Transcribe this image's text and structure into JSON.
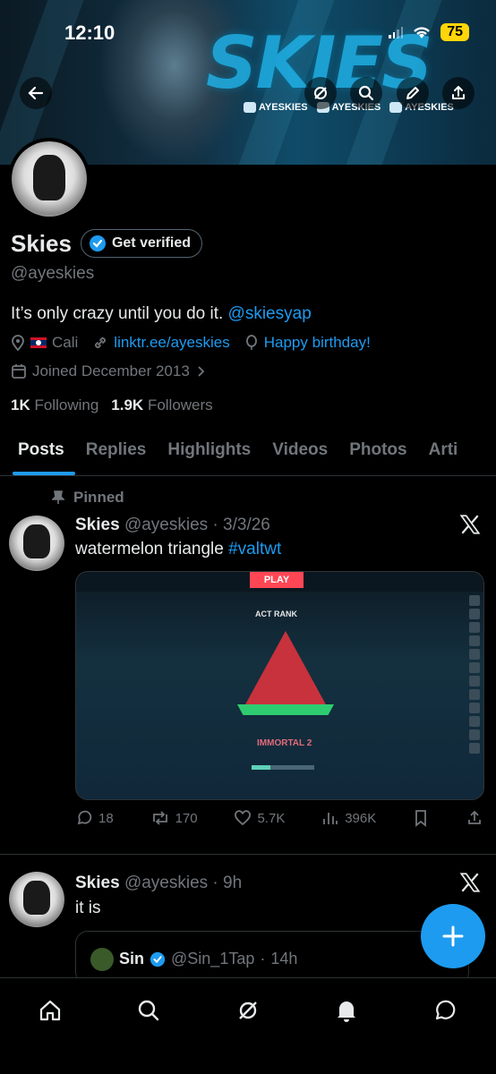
{
  "status_bar": {
    "time": "12:10",
    "battery": "75"
  },
  "banner": {
    "logo_text": "SKIES",
    "socials": [
      {
        "platform": "TWITTER",
        "handle": "AYESKIES"
      },
      {
        "platform": "YOUTUBE",
        "handle": "AYESKIES"
      },
      {
        "platform": "TWITCH",
        "handle": "AYESKIES"
      }
    ]
  },
  "profile": {
    "name": "Skies",
    "get_verified": "Get verified",
    "handle": "@ayeskies",
    "bio_text": "It’s only crazy until you do it.",
    "bio_mention": "@skiesyap",
    "location": "Cali",
    "link": "linktr.ee/ayeskies",
    "birthday": "Happy birthday!",
    "joined": "Joined December 2013",
    "following_count": "1K",
    "following_label": "Following",
    "followers_count": "1.9K",
    "followers_label": "Followers"
  },
  "tabs": [
    "Posts",
    "Replies",
    "Highlights",
    "Videos",
    "Photos",
    "Arti"
  ],
  "pinned_label": "Pinned",
  "tweets": [
    {
      "name": "Skies",
      "handle": "@ayeskies",
      "time": "3/3/26",
      "text": "watermelon triangle",
      "hashtag": "#valtwt",
      "media": {
        "play_label": "PLAY",
        "act_rank_label": "ACT RANK",
        "rank_name": "IMMORTAL 2"
      },
      "replies": "18",
      "reposts": "170",
      "likes": "5.7K",
      "views": "396K"
    },
    {
      "name": "Skies",
      "handle": "@ayeskies",
      "time": "9h",
      "text": "it is",
      "quote": {
        "name": "Sin",
        "handle": "@Sin_1Tap",
        "time": "14h"
      }
    }
  ],
  "colors": {
    "accent": "#1d9bf0",
    "muted": "#71767b",
    "text": "#e7e9ea",
    "battery": "#ffd60a"
  }
}
